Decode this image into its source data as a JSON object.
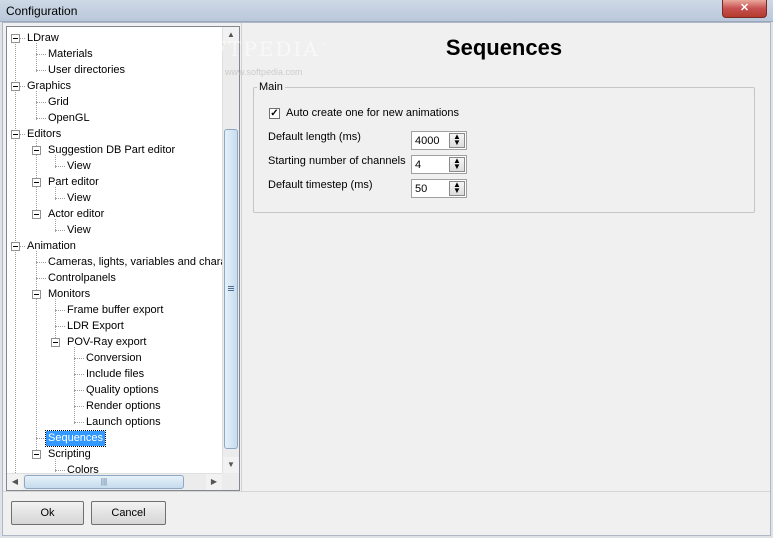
{
  "window": {
    "title": "Configuration",
    "close_glyph": "✕",
    "watermark": "SOFTPEDIA",
    "watermark_mark": "™",
    "watermark_url": "www.softpedia.com"
  },
  "tree": {
    "items": [
      {
        "label": "LDraw"
      },
      {
        "label": "Materials"
      },
      {
        "label": "User directories"
      },
      {
        "label": "Graphics"
      },
      {
        "label": "Grid"
      },
      {
        "label": "OpenGL"
      },
      {
        "label": "Editors"
      },
      {
        "label": "Suggestion DB Part editor"
      },
      {
        "label": "View"
      },
      {
        "label": "Part editor"
      },
      {
        "label": "View"
      },
      {
        "label": "Actor editor"
      },
      {
        "label": "View"
      },
      {
        "label": "Animation"
      },
      {
        "label": "Cameras, lights, variables and characters"
      },
      {
        "label": "Controlpanels"
      },
      {
        "label": "Monitors"
      },
      {
        "label": "Frame buffer export"
      },
      {
        "label": "LDR Export"
      },
      {
        "label": "POV-Ray export"
      },
      {
        "label": "Conversion"
      },
      {
        "label": "Include files"
      },
      {
        "label": "Quality options"
      },
      {
        "label": "Render options"
      },
      {
        "label": "Launch options"
      },
      {
        "label": "Sequences"
      },
      {
        "label": "Scripting"
      },
      {
        "label": "Colors"
      }
    ],
    "selected": "Sequences"
  },
  "page": {
    "title": "Sequences",
    "group_label": "Main",
    "auto_create_label": "Auto create one for new animations",
    "auto_create_checked": true,
    "fields": [
      {
        "label": "Default length (ms)",
        "value": "4000"
      },
      {
        "label": "Starting number of channels",
        "value": "4"
      },
      {
        "label": "Default timestep (ms)",
        "value": "50"
      }
    ]
  },
  "buttons": {
    "ok": "Ok",
    "cancel": "Cancel"
  },
  "colors": {
    "selection": "#3399ff",
    "window_bg": "#f0f0f0"
  }
}
